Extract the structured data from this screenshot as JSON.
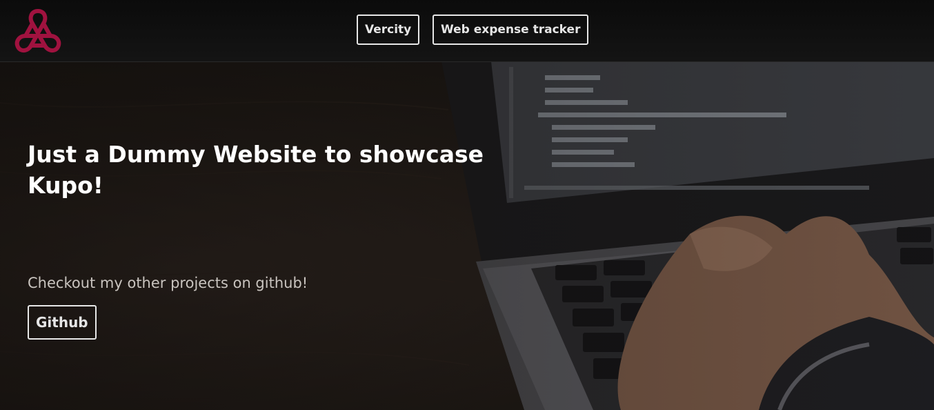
{
  "nav": {
    "links": [
      {
        "label": "Vercity"
      },
      {
        "label": "Web expense tracker"
      }
    ]
  },
  "hero": {
    "headline": "Just a Dummy Website to showcase Kupo!",
    "subtext": "Checkout my other projects on github!",
    "cta_label": "Github"
  },
  "colors": {
    "logo": "#a0123f",
    "nav_bg": "#0d0d0d",
    "text": "#ffffff"
  },
  "icons": {
    "logo": "trefoil-logo-icon"
  }
}
